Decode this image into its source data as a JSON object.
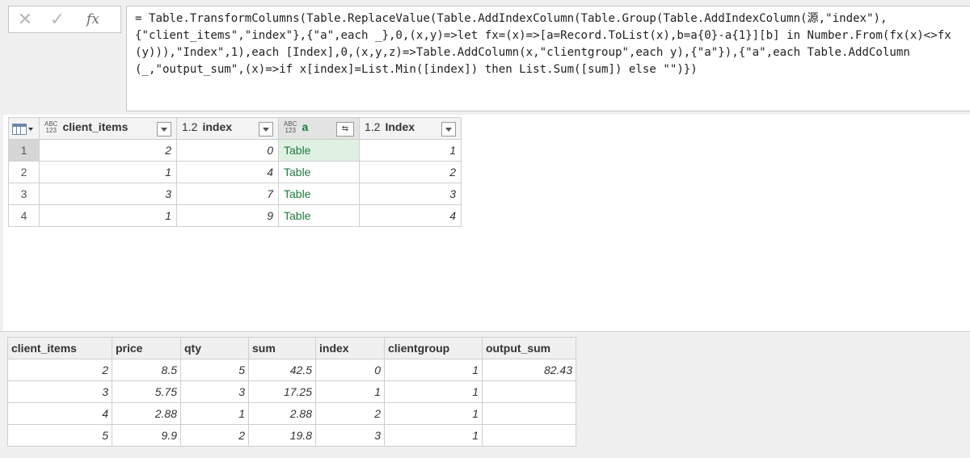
{
  "formula_bar": {
    "cancel_icon": "✕",
    "commit_icon": "✓",
    "fx_label": "fx",
    "lines": [
      "= Table.TransformColumns(Table.ReplaceValue(Table.AddIndexColumn(Table.Group(Table.AddIndexColumn(源,\"index\"),",
      "{\"client_items\",\"index\"},{\"a\",each _},0,(x,y)=>let fx=(x)=>[a=Record.ToList(x),b=a{0}-a{1}][b] in Number.From(fx(x)<>fx",
      "(y))),\"Index\",1),each [Index],0,(x,y,z)=>Table.AddColumn(x,\"clientgroup\",each y),{\"a\"}),{\"a\",each Table.AddColumn",
      "(_,\"output_sum\",(x)=>if x[index]=List.Min([index]) then List.Sum([sum]) else \"\")})"
    ]
  },
  "query_table": {
    "columns": [
      {
        "type": "ABC\n123",
        "label": "client_items"
      },
      {
        "type": "1.2",
        "label": "index"
      },
      {
        "type": "ABC\n123",
        "label": "a"
      },
      {
        "type": "1.2",
        "label": "Index"
      }
    ],
    "rows": [
      {
        "n": "1",
        "client_items": "2",
        "index": "0",
        "a": "Table",
        "Index": "1"
      },
      {
        "n": "2",
        "client_items": "1",
        "index": "4",
        "a": "Table",
        "Index": "2"
      },
      {
        "n": "3",
        "client_items": "3",
        "index": "7",
        "a": "Table",
        "Index": "3"
      },
      {
        "n": "4",
        "client_items": "1",
        "index": "9",
        "a": "Table",
        "Index": "4"
      }
    ]
  },
  "preview_table": {
    "columns": [
      "client_items",
      "price",
      "qty",
      "sum",
      "index",
      "clientgroup",
      "output_sum"
    ],
    "rows": [
      [
        "2",
        "8.5",
        "5",
        "42.5",
        "0",
        "1",
        "82.43"
      ],
      [
        "3",
        "5.75",
        "3",
        "17.25",
        "1",
        "1",
        ""
      ],
      [
        "4",
        "2.88",
        "1",
        "2.88",
        "2",
        "1",
        ""
      ],
      [
        "5",
        "9.9",
        "2",
        "19.8",
        "3",
        "1",
        ""
      ]
    ]
  },
  "colors": {
    "table_value": "#1e7a3d",
    "selected_cell": "#dff1e2"
  }
}
